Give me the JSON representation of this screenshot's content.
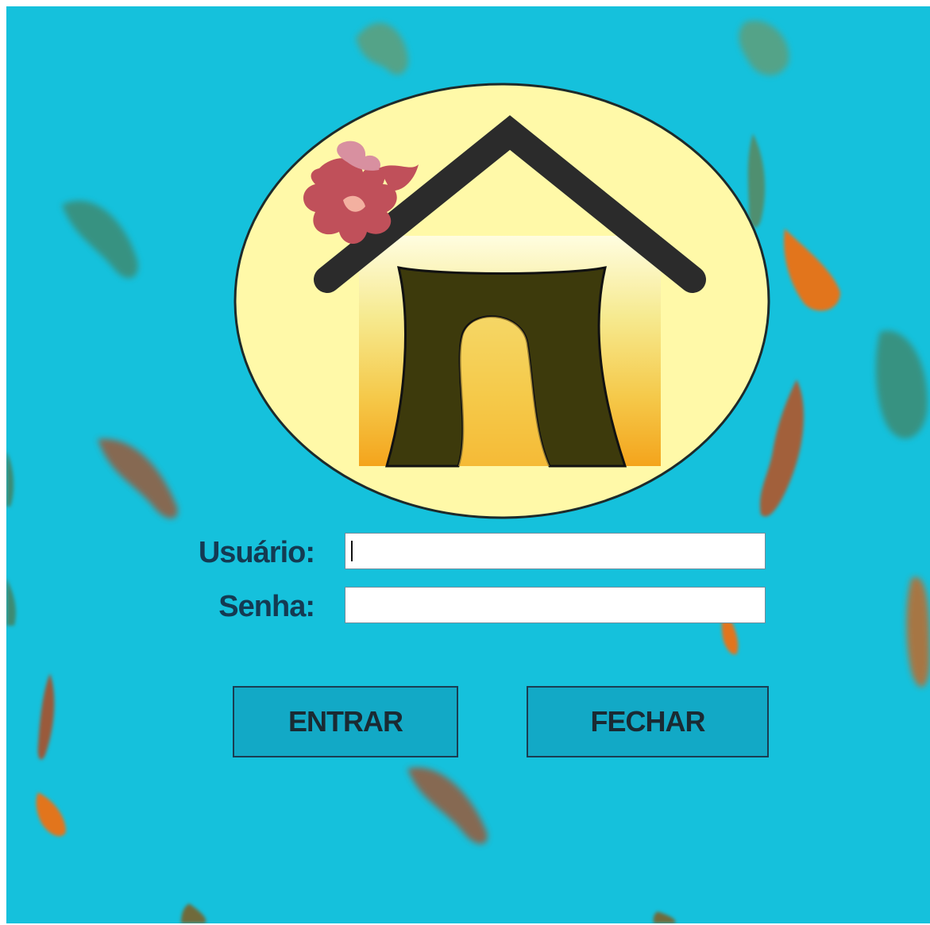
{
  "login": {
    "user_label": "Usuário:",
    "password_label": "Senha:",
    "user_value": "",
    "password_value": ""
  },
  "actions": {
    "enter_label": "ENTRAR",
    "close_label": "FECHAR"
  },
  "colors": {
    "background": "#15c1dc",
    "logo_circle": "#fff9a8",
    "house_frame": "#3d3a0c",
    "roof": "#2b2b2b",
    "button_fill": "#12a9c6",
    "label_text": "#143a52"
  },
  "icons": {
    "logo": "house-logo-icon",
    "flower": "flower-icon",
    "leaves": "leaf-icon"
  }
}
